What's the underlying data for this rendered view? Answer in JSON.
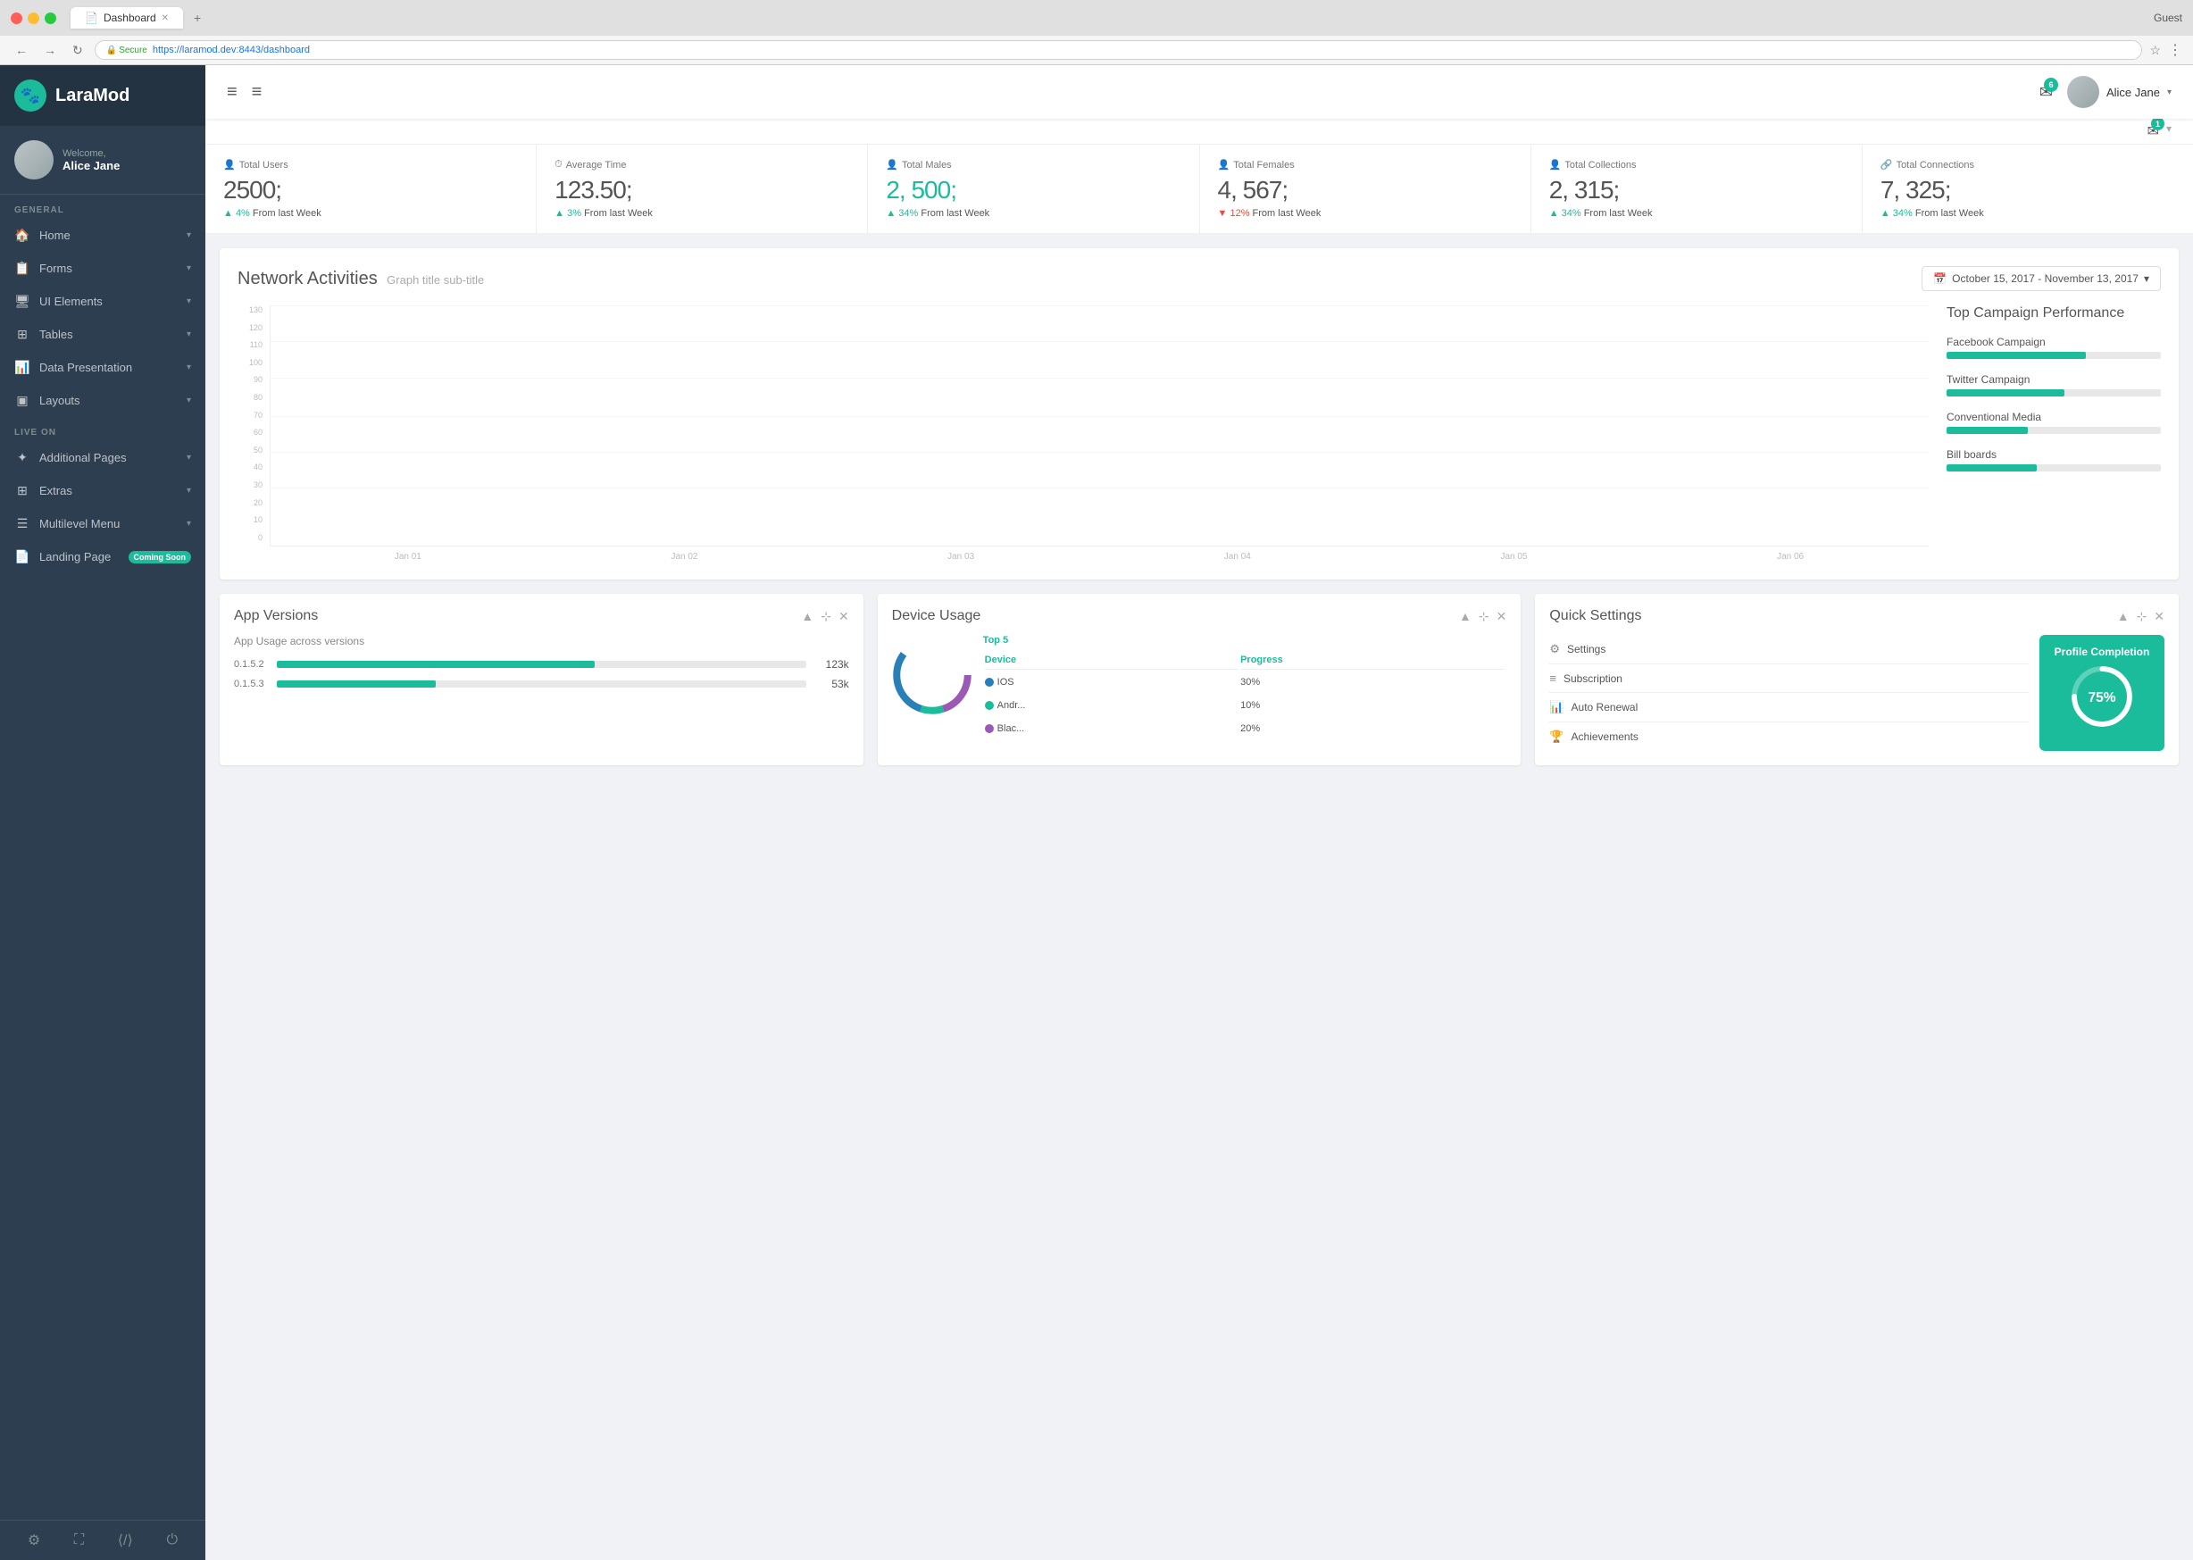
{
  "browser": {
    "tab_title": "Dashboard",
    "url": "https://laramod.dev:8443/dashboard",
    "secure_text": "Secure",
    "guest_label": "Guest"
  },
  "sidebar": {
    "logo_text": "LaraMod",
    "welcome_text": "Welcome,",
    "user_name": "Alice Jane",
    "general_label": "GENERAL",
    "live_on_label": "LIVE ON",
    "items": [
      {
        "label": "Home",
        "icon": "🏠",
        "has_chevron": true
      },
      {
        "label": "Forms",
        "icon": "📋",
        "has_chevron": true
      },
      {
        "label": "UI Elements",
        "icon": "🖥",
        "has_chevron": true
      },
      {
        "label": "Tables",
        "icon": "⊞",
        "has_chevron": true
      },
      {
        "label": "Data Presentation",
        "icon": "📊",
        "has_chevron": true
      },
      {
        "label": "Layouts",
        "icon": "▣",
        "has_chevron": true
      }
    ],
    "live_items": [
      {
        "label": "Additional Pages",
        "icon": "✦",
        "has_chevron": true
      },
      {
        "label": "Extras",
        "icon": "⊞",
        "has_chevron": true
      },
      {
        "label": "Multilevel Menu",
        "icon": "☰",
        "has_chevron": true
      },
      {
        "label": "Landing Page",
        "icon": "📄",
        "badge": "Coming Soon"
      }
    ]
  },
  "topbar": {
    "notif_count": "6",
    "notif2_count": "1",
    "user_name": "Alice Jane"
  },
  "stats": [
    {
      "label": "Total Users",
      "icon": "👤",
      "value": "2500;",
      "change": "4% From last Week",
      "direction": "up",
      "teal": false
    },
    {
      "label": "Average Time",
      "icon": "⏱",
      "value": "123.50;",
      "change": "3% From last Week",
      "direction": "up",
      "teal": false
    },
    {
      "label": "Total Males",
      "icon": "👤",
      "value": "2, 500;",
      "change": "34% From last Week",
      "direction": "up",
      "teal": true
    },
    {
      "label": "Total Females",
      "icon": "👤",
      "value": "4, 567;",
      "change": "12% From last Week",
      "direction": "down",
      "teal": false
    },
    {
      "label": "Total Collections",
      "icon": "👤",
      "value": "2, 315;",
      "change": "34% From last Week",
      "direction": "up",
      "teal": false
    },
    {
      "label": "Total Connections",
      "icon": "🔗",
      "value": "7, 325;",
      "change": "34% From last Week",
      "direction": "up",
      "teal": false
    }
  ],
  "network_chart": {
    "title": "Network Activities",
    "subtitle": "Graph title sub-title",
    "date_range": "October 15, 2017 - November 13, 2017",
    "y_labels": [
      "0",
      "10",
      "20",
      "30",
      "40",
      "50",
      "60",
      "70",
      "80",
      "90",
      "100",
      "110",
      "120",
      "130"
    ],
    "x_labels": [
      "Jan 01",
      "Jan 02",
      "Jan 03",
      "Jan 04",
      "Jan 05",
      "Jan 06"
    ],
    "top_campaign_title": "Top Campaign Performance",
    "campaigns": [
      {
        "name": "Facebook Campaign",
        "percent": 65
      },
      {
        "name": "Twitter Campaign",
        "percent": 55
      },
      {
        "name": "Conventional Media",
        "percent": 38
      },
      {
        "name": "Bill boards",
        "percent": 42
      }
    ]
  },
  "app_versions": {
    "title": "App Versions",
    "subtitle": "App Usage across versions",
    "versions": [
      {
        "label": "0.1.5.2",
        "bar_percent": 60,
        "value": "123k"
      },
      {
        "label": "0.1.5.3",
        "bar_percent": 30,
        "value": "53k"
      }
    ],
    "controls": [
      "▲",
      "⊹",
      "✕"
    ]
  },
  "device_usage": {
    "title": "Device Usage",
    "subtitle": "Top 5",
    "col_device": "Device",
    "col_progress": "Progress",
    "devices": [
      {
        "name": "IOS",
        "color": "#2980b9",
        "percent": "30%"
      },
      {
        "name": "Andr...",
        "color": "#1abc9c",
        "percent": "10%"
      },
      {
        "name": "Blac...",
        "color": "#9b59b6",
        "percent": "20%"
      }
    ],
    "controls": [
      "▲",
      "⊹",
      "✕"
    ]
  },
  "quick_settings": {
    "title": "Quick Settings",
    "items": [
      {
        "icon": "⚙",
        "label": "Settings"
      },
      {
        "icon": "≡",
        "label": "Subscription"
      },
      {
        "icon": "📊",
        "label": "Auto Renewal"
      },
      {
        "icon": "🏆",
        "label": "Achievements"
      }
    ],
    "profile_completion": {
      "title": "Profile Completion",
      "percent": 75
    },
    "controls": [
      "▲",
      "⊹",
      "✕"
    ]
  }
}
